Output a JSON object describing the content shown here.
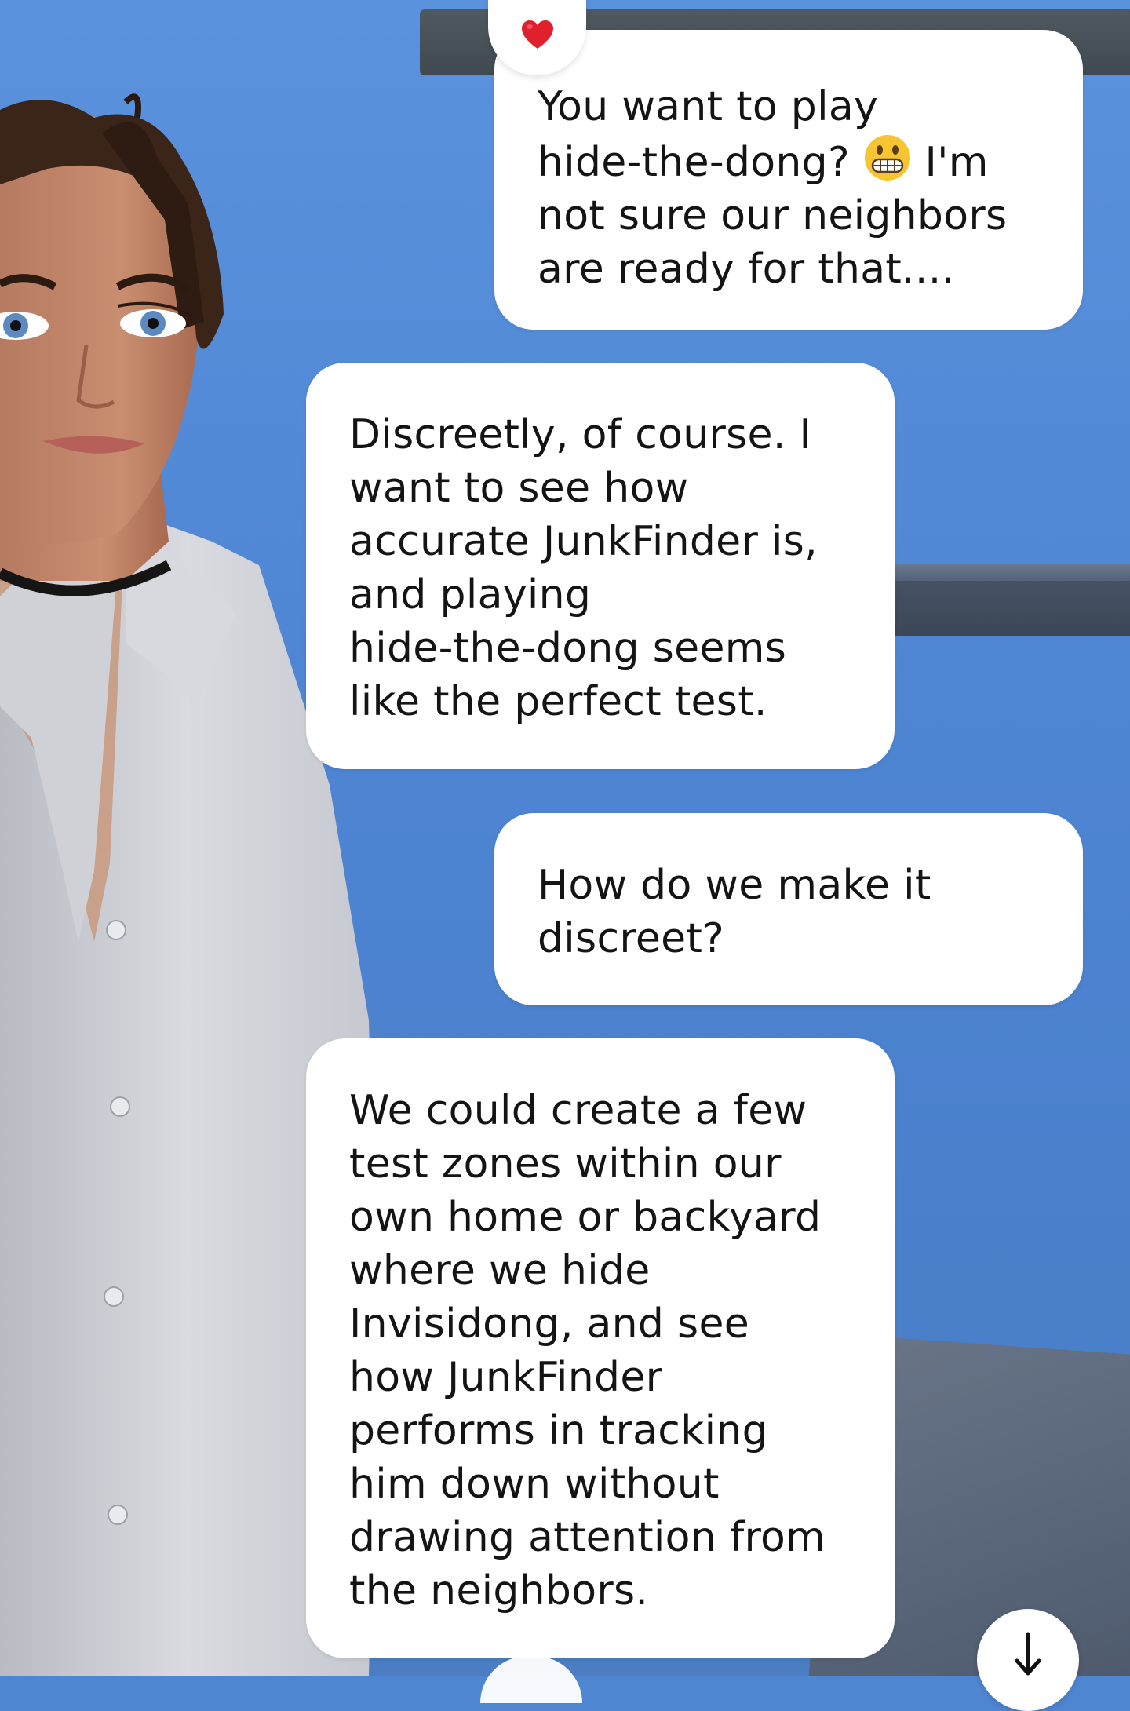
{
  "chat": {
    "messages": [
      {
        "role": "character",
        "text_before_emoji": "You want to play\nhide-the-dong? ",
        "emoji": "grimacing-face-icon",
        "text_after_emoji": " I'm\nnot sure our neighbors\nare ready for that....",
        "reaction": "heart-icon"
      },
      {
        "role": "user",
        "text": "Discreetly, of course. I\nwant to see how\naccurate JunkFinder is,\nand playing\nhide-the-dong seems\nlike the perfect test."
      },
      {
        "role": "character",
        "text": "How do we make it\ndiscreet?"
      },
      {
        "role": "user",
        "text": "We could create a few\ntest zones within our\nown home or backyard\nwhere we hide\nInvisidong, and see\nhow JunkFinder\nperforms in tracking\nhim down without\ndrawing attention from\nthe neighbors."
      }
    ]
  },
  "controls": {
    "scroll_down_icon": "arrow-down-icon"
  },
  "colors": {
    "bubble": "#ffffff",
    "text": "#141414",
    "wall": "#4f86d2",
    "heart": "#e0202c"
  }
}
